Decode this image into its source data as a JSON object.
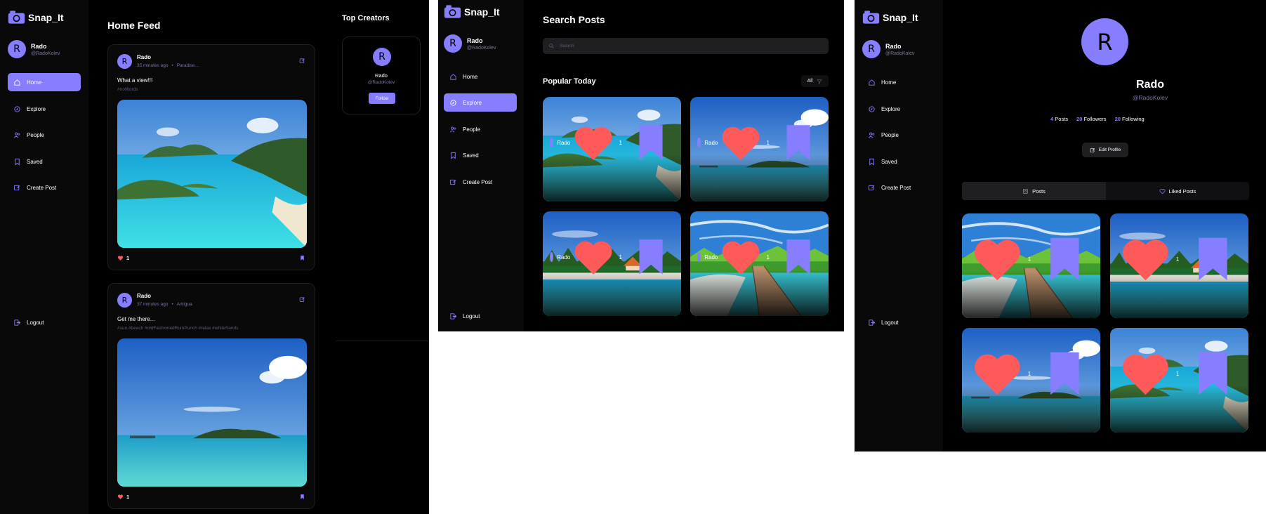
{
  "colors": {
    "accent": "#877eff",
    "background": "#000000",
    "sidebar": "#09090a",
    "like": "#ff5a5a",
    "muted": "#7878a3"
  },
  "app": {
    "name": "Snap_It"
  },
  "user": {
    "initial": "R",
    "name": "Rado",
    "handle": "@RadoKolev"
  },
  "nav": [
    "Home",
    "Explore",
    "People",
    "Saved",
    "Create Post"
  ],
  "logout": "Logout",
  "home": {
    "title": "Home Feed",
    "posts": [
      {
        "author": "Rado",
        "time": "35 minutes ago",
        "location": "Paradise...",
        "caption": "What a view!!!",
        "tags": "#noWords",
        "likes": "1",
        "image": "bay"
      },
      {
        "author": "Rado",
        "time": "37 minutes ago",
        "location": "Antigua",
        "caption": "Get me there...",
        "tags": "#sun #beach #oldFashionedRumPunch #relax #whiteSands",
        "likes": "1",
        "image": "sea"
      }
    ],
    "top_creators_title": "Top Creators",
    "creator": {
      "initial": "R",
      "name": "Rado",
      "handle": "@RadoKolev",
      "follow": "Follow"
    }
  },
  "explore": {
    "title": "Search Posts",
    "search_placeholder": "Search",
    "popular_title": "Popular Today",
    "filter": "All",
    "grid": [
      {
        "author": "Rado",
        "likes": "1",
        "image": "bay"
      },
      {
        "author": "Rado",
        "likes": "1",
        "image": "sea"
      },
      {
        "author": "Rado",
        "likes": "1",
        "image": "huts"
      },
      {
        "author": "Rado",
        "likes": "1",
        "image": "pier"
      }
    ]
  },
  "profile": {
    "initial": "R",
    "name": "Rado",
    "handle": "@RadoKolev",
    "stats": [
      {
        "value": "4",
        "label": "Posts"
      },
      {
        "value": "20",
        "label": "Followers"
      },
      {
        "value": "20",
        "label": "Following"
      }
    ],
    "edit": "Edit Profile",
    "tabs": [
      "Posts",
      "Liked Posts"
    ],
    "grid": [
      {
        "likes": "1",
        "image": "pier"
      },
      {
        "likes": "1",
        "image": "huts"
      },
      {
        "likes": "1",
        "image": "sea"
      },
      {
        "likes": "1",
        "image": "bay"
      }
    ]
  }
}
